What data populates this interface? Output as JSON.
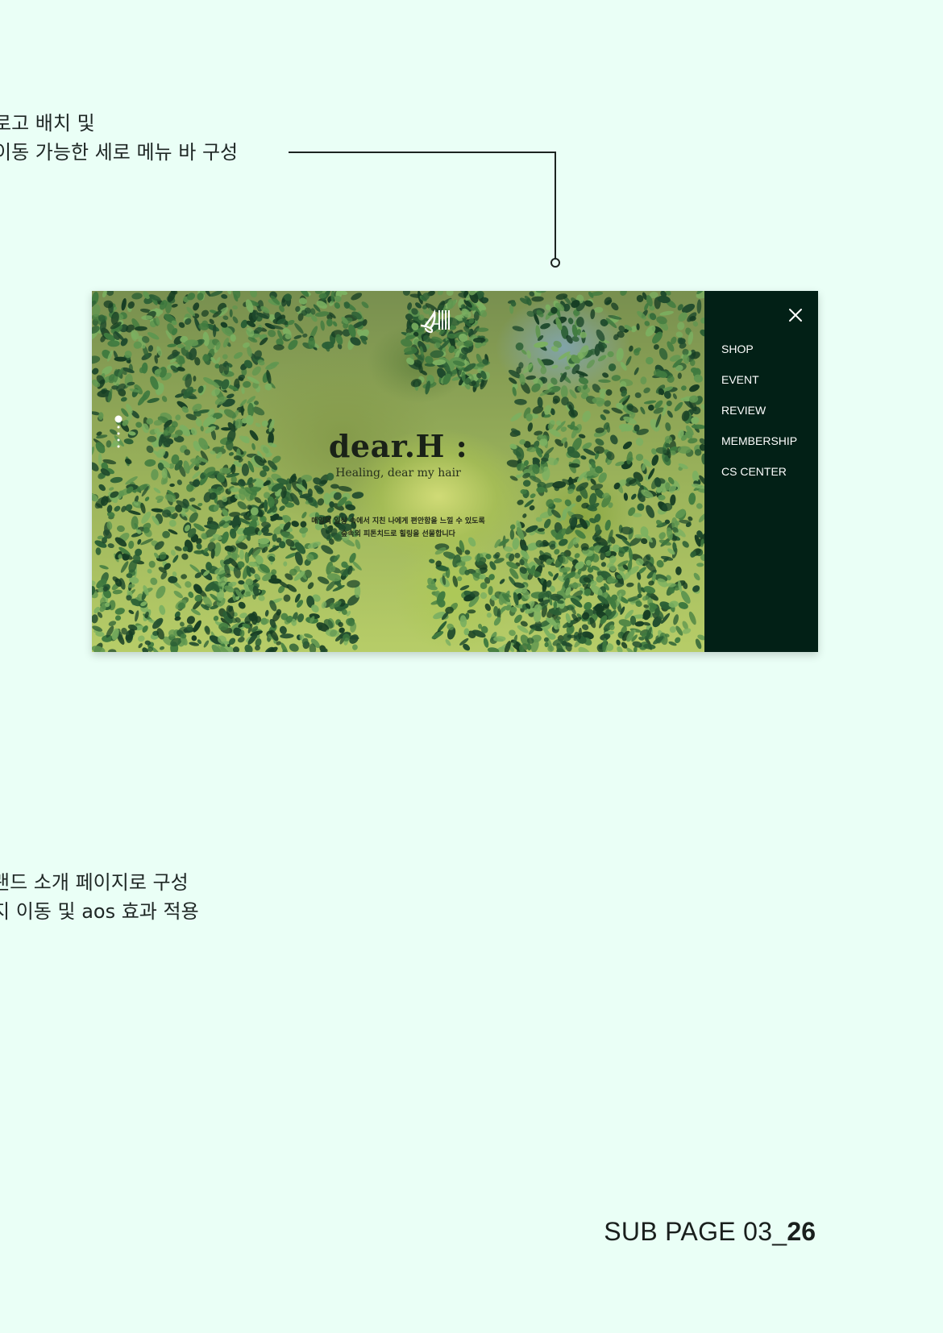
{
  "annotations": {
    "top": {
      "line1": "로고  배치 및",
      "line2": "이동 가능한 세로 메뉴 바 구성"
    },
    "bottom": {
      "line1": "랜드 소개 페이지로 구성",
      "line2": "지 이동 및 aos 효과 적용"
    }
  },
  "mockup": {
    "logo_icon": "dear-logo-icon",
    "brand_title": "dear.H :",
    "tagline": "Healing, dear my hair",
    "copy_line1": "매일의 일상 속에서 지친 나에게 편안함을 느낄 수 있도록",
    "copy_line2": "숲속의 피톤치드로 힐링을 선물합니다",
    "dot_nav": {
      "count": 5,
      "active_index": 0
    },
    "side_menu": {
      "close_icon": "close-icon",
      "items": [
        "SHOP",
        "EVENT",
        "REVIEW",
        "MEMBERSHIP",
        "CS CENTER"
      ]
    }
  },
  "footer": {
    "page_prefix": "SUB PAGE 03_",
    "page_number": "26"
  },
  "colors": {
    "background": "#eafff6",
    "menu_background": "#022016",
    "foliage_dark": "#1f4a2d",
    "foliage_light": "#6fa05d"
  }
}
